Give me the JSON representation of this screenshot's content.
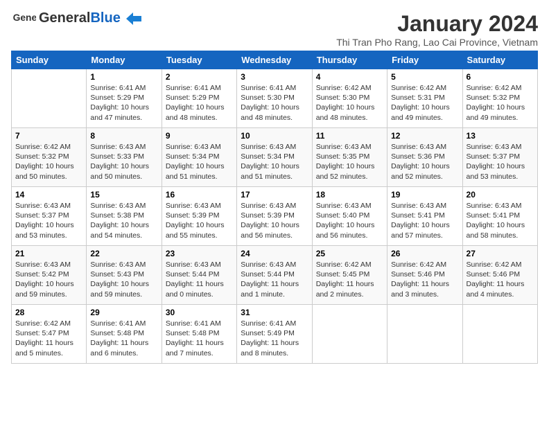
{
  "header": {
    "logo_general": "General",
    "logo_blue": "Blue",
    "title": "January 2024",
    "subtitle": "Thi Tran Pho Rang, Lao Cai Province, Vietnam"
  },
  "columns": [
    "Sunday",
    "Monday",
    "Tuesday",
    "Wednesday",
    "Thursday",
    "Friday",
    "Saturday"
  ],
  "weeks": [
    [
      {
        "day": "",
        "detail": ""
      },
      {
        "day": "1",
        "detail": "Sunrise: 6:41 AM\nSunset: 5:29 PM\nDaylight: 10 hours\nand 47 minutes."
      },
      {
        "day": "2",
        "detail": "Sunrise: 6:41 AM\nSunset: 5:29 PM\nDaylight: 10 hours\nand 48 minutes."
      },
      {
        "day": "3",
        "detail": "Sunrise: 6:41 AM\nSunset: 5:30 PM\nDaylight: 10 hours\nand 48 minutes."
      },
      {
        "day": "4",
        "detail": "Sunrise: 6:42 AM\nSunset: 5:30 PM\nDaylight: 10 hours\nand 48 minutes."
      },
      {
        "day": "5",
        "detail": "Sunrise: 6:42 AM\nSunset: 5:31 PM\nDaylight: 10 hours\nand 49 minutes."
      },
      {
        "day": "6",
        "detail": "Sunrise: 6:42 AM\nSunset: 5:32 PM\nDaylight: 10 hours\nand 49 minutes."
      }
    ],
    [
      {
        "day": "7",
        "detail": "Sunrise: 6:42 AM\nSunset: 5:32 PM\nDaylight: 10 hours\nand 50 minutes."
      },
      {
        "day": "8",
        "detail": "Sunrise: 6:43 AM\nSunset: 5:33 PM\nDaylight: 10 hours\nand 50 minutes."
      },
      {
        "day": "9",
        "detail": "Sunrise: 6:43 AM\nSunset: 5:34 PM\nDaylight: 10 hours\nand 51 minutes."
      },
      {
        "day": "10",
        "detail": "Sunrise: 6:43 AM\nSunset: 5:34 PM\nDaylight: 10 hours\nand 51 minutes."
      },
      {
        "day": "11",
        "detail": "Sunrise: 6:43 AM\nSunset: 5:35 PM\nDaylight: 10 hours\nand 52 minutes."
      },
      {
        "day": "12",
        "detail": "Sunrise: 6:43 AM\nSunset: 5:36 PM\nDaylight: 10 hours\nand 52 minutes."
      },
      {
        "day": "13",
        "detail": "Sunrise: 6:43 AM\nSunset: 5:37 PM\nDaylight: 10 hours\nand 53 minutes."
      }
    ],
    [
      {
        "day": "14",
        "detail": "Sunrise: 6:43 AM\nSunset: 5:37 PM\nDaylight: 10 hours\nand 53 minutes."
      },
      {
        "day": "15",
        "detail": "Sunrise: 6:43 AM\nSunset: 5:38 PM\nDaylight: 10 hours\nand 54 minutes."
      },
      {
        "day": "16",
        "detail": "Sunrise: 6:43 AM\nSunset: 5:39 PM\nDaylight: 10 hours\nand 55 minutes."
      },
      {
        "day": "17",
        "detail": "Sunrise: 6:43 AM\nSunset: 5:39 PM\nDaylight: 10 hours\nand 56 minutes."
      },
      {
        "day": "18",
        "detail": "Sunrise: 6:43 AM\nSunset: 5:40 PM\nDaylight: 10 hours\nand 56 minutes."
      },
      {
        "day": "19",
        "detail": "Sunrise: 6:43 AM\nSunset: 5:41 PM\nDaylight: 10 hours\nand 57 minutes."
      },
      {
        "day": "20",
        "detail": "Sunrise: 6:43 AM\nSunset: 5:41 PM\nDaylight: 10 hours\nand 58 minutes."
      }
    ],
    [
      {
        "day": "21",
        "detail": "Sunrise: 6:43 AM\nSunset: 5:42 PM\nDaylight: 10 hours\nand 59 minutes."
      },
      {
        "day": "22",
        "detail": "Sunrise: 6:43 AM\nSunset: 5:43 PM\nDaylight: 10 hours\nand 59 minutes."
      },
      {
        "day": "23",
        "detail": "Sunrise: 6:43 AM\nSunset: 5:44 PM\nDaylight: 11 hours\nand 0 minutes."
      },
      {
        "day": "24",
        "detail": "Sunrise: 6:43 AM\nSunset: 5:44 PM\nDaylight: 11 hours\nand 1 minute."
      },
      {
        "day": "25",
        "detail": "Sunrise: 6:42 AM\nSunset: 5:45 PM\nDaylight: 11 hours\nand 2 minutes."
      },
      {
        "day": "26",
        "detail": "Sunrise: 6:42 AM\nSunset: 5:46 PM\nDaylight: 11 hours\nand 3 minutes."
      },
      {
        "day": "27",
        "detail": "Sunrise: 6:42 AM\nSunset: 5:46 PM\nDaylight: 11 hours\nand 4 minutes."
      }
    ],
    [
      {
        "day": "28",
        "detail": "Sunrise: 6:42 AM\nSunset: 5:47 PM\nDaylight: 11 hours\nand 5 minutes."
      },
      {
        "day": "29",
        "detail": "Sunrise: 6:41 AM\nSunset: 5:48 PM\nDaylight: 11 hours\nand 6 minutes."
      },
      {
        "day": "30",
        "detail": "Sunrise: 6:41 AM\nSunset: 5:48 PM\nDaylight: 11 hours\nand 7 minutes."
      },
      {
        "day": "31",
        "detail": "Sunrise: 6:41 AM\nSunset: 5:49 PM\nDaylight: 11 hours\nand 8 minutes."
      },
      {
        "day": "",
        "detail": ""
      },
      {
        "day": "",
        "detail": ""
      },
      {
        "day": "",
        "detail": ""
      }
    ]
  ]
}
